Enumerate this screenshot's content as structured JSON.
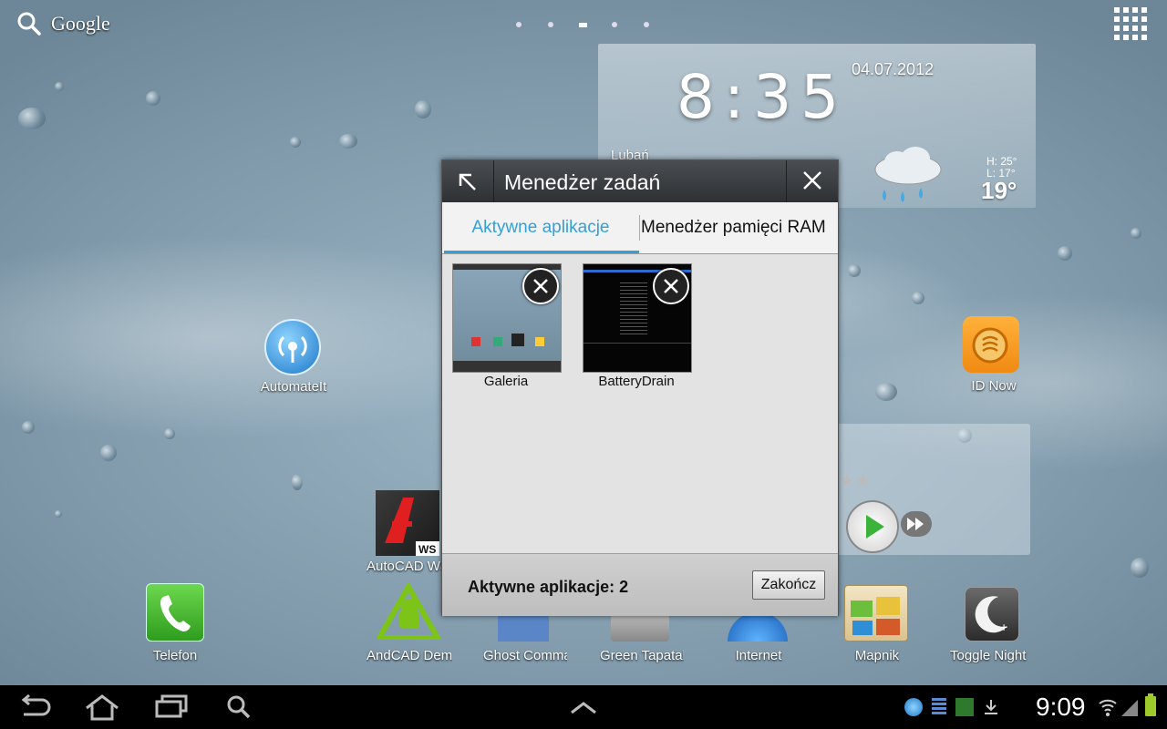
{
  "search": {
    "label": "Google"
  },
  "clock": {
    "time_h": "8",
    "time_m": "35",
    "date": "04.07.2012",
    "city": "Lubań"
  },
  "weather": {
    "high": "H:  25°",
    "low": "L:  17°",
    "current": "19°"
  },
  "desktop": {
    "apps": [
      {
        "label": "AutomateIt"
      },
      {
        "label": "ID Now"
      },
      {
        "label": "AutoCAD WS"
      }
    ],
    "dock": [
      {
        "label": "Telefon"
      },
      {
        "label": "AndCAD Demo"
      },
      {
        "label": "Ghost Commander"
      },
      {
        "label": "Green Tapatalk"
      },
      {
        "label": "Internet"
      },
      {
        "label": "Mapnik"
      },
      {
        "label": "Toggle Night"
      }
    ]
  },
  "dialog": {
    "title": "Menedżer zadań",
    "tabs": [
      {
        "label": "Aktywne aplikacje"
      },
      {
        "label": "Menedżer pamięci RAM"
      }
    ],
    "apps": [
      {
        "label": "Galeria"
      },
      {
        "label": "BatteryDrain"
      }
    ],
    "footer_count": "Aktywne aplikacje: 2",
    "end_button": "Zakończ"
  },
  "status": {
    "time": "9:09"
  },
  "colors": {
    "accent": "#33a0d8",
    "battery": "#9ccb2b",
    "dialog_bg": "#e3e3e3"
  }
}
